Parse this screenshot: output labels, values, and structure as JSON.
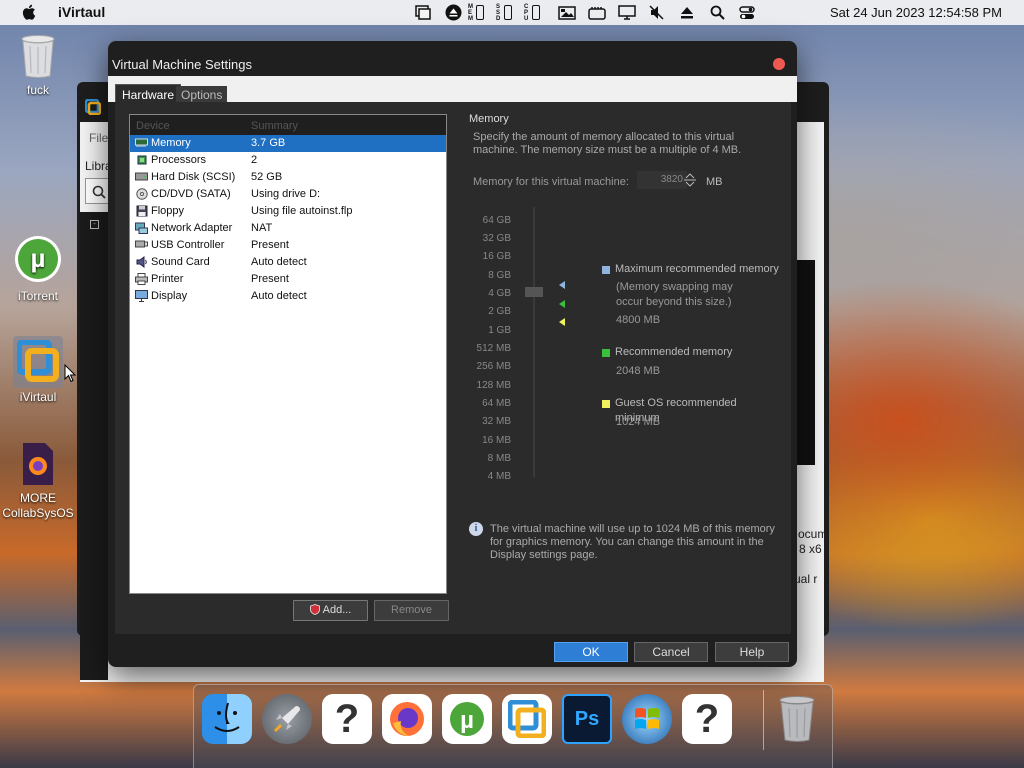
{
  "menubar": {
    "app_name": "iVirtaul",
    "status_labels": {
      "mem": "MEM",
      "ssd": "SSD",
      "cpu": "CPU"
    },
    "clock": "Sat 24 Jun 2023  12:54:58 PM",
    "icons": [
      "wifi-sync-icon",
      "eject-circle-icon",
      "image-icon",
      "card-icon",
      "display-icon",
      "mute-icon",
      "eject-icon",
      "search-icon",
      "control-center-icon"
    ]
  },
  "desktop": {
    "icons": [
      {
        "label": "fuck",
        "icon": "trash-icon"
      },
      {
        "label": "iTorrent",
        "icon": "utorrent-icon"
      },
      {
        "label": "iVirtaul",
        "icon": "vmware-icon"
      },
      {
        "label": "MORE\nCollabSysOS",
        "icon": "firefox-doc-icon"
      }
    ]
  },
  "background_window": {
    "snippets": {
      "file": "File",
      "library": "Libra",
      "doc1": "ocum",
      "doc2": "8 x6",
      "doc3": "ual r"
    }
  },
  "dialog": {
    "title": "Virtual Machine Settings",
    "tabs": [
      {
        "label": "Hardware"
      },
      {
        "label": "Options"
      }
    ],
    "columns": {
      "device": "Device",
      "summary": "Summary"
    },
    "devices": [
      {
        "name": "Memory",
        "summary": "3.7 GB",
        "icon": "memory-icon",
        "selected": true
      },
      {
        "name": "Processors",
        "summary": "2",
        "icon": "cpu-icon"
      },
      {
        "name": "Hard Disk (SCSI)",
        "summary": "52 GB",
        "icon": "hard-disk-icon"
      },
      {
        "name": "CD/DVD (SATA)",
        "summary": "Using drive D:",
        "icon": "cd-icon"
      },
      {
        "name": "Floppy",
        "summary": "Using file autoinst.flp",
        "icon": "floppy-icon"
      },
      {
        "name": "Network Adapter",
        "summary": "NAT",
        "icon": "network-icon"
      },
      {
        "name": "USB Controller",
        "summary": "Present",
        "icon": "usb-icon"
      },
      {
        "name": "Sound Card",
        "summary": "Auto detect",
        "icon": "sound-icon"
      },
      {
        "name": "Printer",
        "summary": "Present",
        "icon": "printer-icon"
      },
      {
        "name": "Display",
        "summary": "Auto detect",
        "icon": "display-icon"
      }
    ],
    "add_label": "Add...",
    "remove_label": "Remove",
    "memory": {
      "title": "Memory",
      "description": "Specify the amount of memory allocated to this virtual machine. The memory size must be a multiple of 4 MB.",
      "field_label": "Memory for this virtual machine:",
      "value": "3820",
      "unit": "MB",
      "scale": [
        "64 GB",
        "32 GB",
        "16 GB",
        "8 GB",
        "4 GB",
        "2 GB",
        "1 GB",
        "512 MB",
        "256 MB",
        "128 MB",
        "64 MB",
        "32 MB",
        "16 MB",
        "8 MB",
        "4 MB"
      ],
      "legend": [
        {
          "title": "Maximum recommended memory",
          "note": "(Memory swapping may occur beyond this size.)",
          "value": "4800 MB",
          "color": "#8fb4e0"
        },
        {
          "title": "Recommended memory",
          "value": "2048 MB",
          "color": "#3cbf3c"
        },
        {
          "title": "Guest OS recommended minimum",
          "value": "1024 MB",
          "color": "#f0f060"
        }
      ],
      "info": "The virtual machine will use up to 1024 MB of this memory for graphics memory. You can change this amount in the Display settings page."
    },
    "buttons": {
      "ok": "OK",
      "cancel": "Cancel",
      "help": "Help"
    }
  },
  "dock": {
    "items": [
      "finder-icon",
      "launchpad-icon",
      "unknown-app-icon",
      "firefox-icon",
      "utorrent-icon",
      "vmware-icon",
      "photoshop-icon",
      "windows-icon",
      "unknown-app-icon-2",
      "trash-icon"
    ]
  }
}
